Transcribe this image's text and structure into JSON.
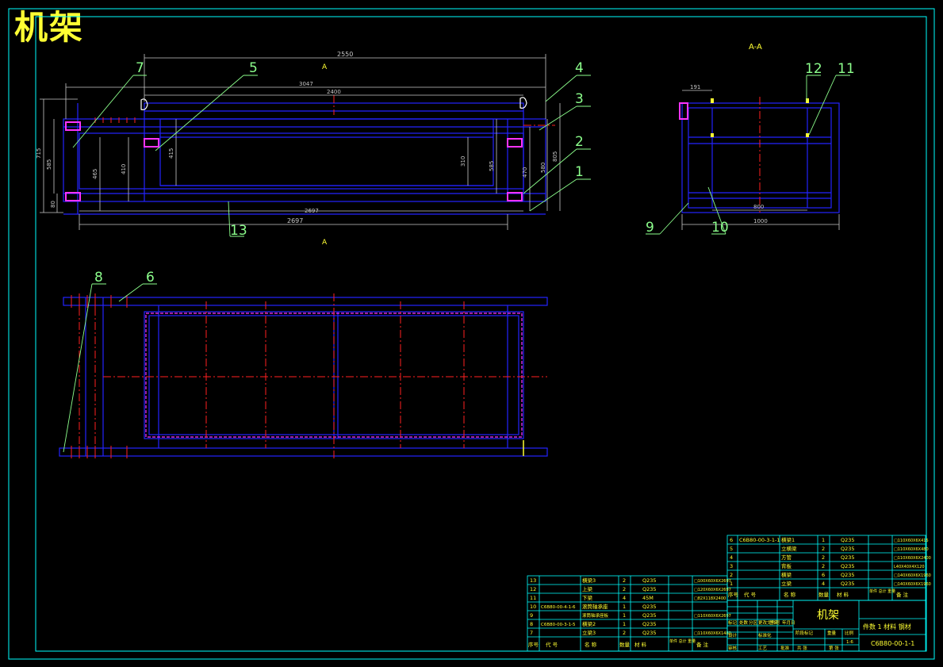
{
  "title": "机架",
  "section_label": "A-A",
  "section_marks": [
    "A",
    "A"
  ],
  "colors": {
    "background": "#000000",
    "frame": "#00ffff",
    "outline": "#2323ff",
    "center_line": "#ff2020",
    "dimension": "#c8c8c8",
    "leader": "#8cff8c",
    "bolt": "#ff33ff",
    "accent": "#ffff33"
  },
  "front_view": {
    "dims": {
      "d2550": "2550",
      "d3047": "3047",
      "d2400": "2400",
      "d2697a": "2697",
      "d2697b": "2697",
      "d715": "715",
      "d585a": "585",
      "d80": "80",
      "d465": "465",
      "d410": "410",
      "d415": "415",
      "d310": "310",
      "d585b": "585",
      "d470": "470",
      "d580": "580",
      "d805": "805"
    },
    "balloons": {
      "b7": "7",
      "b5": "5",
      "b4": "4",
      "b3": "3",
      "b2": "2",
      "b1": "1",
      "b13": "13"
    }
  },
  "section_view": {
    "dims": {
      "d191": "191",
      "d800": "800",
      "d1000": "1000"
    },
    "balloons": {
      "b12": "12",
      "b11": "11",
      "b9": "9",
      "b10": "10"
    }
  },
  "top_view": {
    "balloons": {
      "b8": "8",
      "b6": "6"
    }
  },
  "bom_right": {
    "rows": [
      [
        "6",
        "C6B80-00-3-1-1",
        "横梁1",
        "1",
        "Q235",
        "□110X60X6X415"
      ],
      [
        "5",
        "",
        "立横梁",
        "2",
        "Q235",
        "□110X60X6X480"
      ],
      [
        "4",
        "",
        "方管",
        "2",
        "Q235",
        "□110X60X6X2400"
      ],
      [
        "3",
        "",
        "背板",
        "2",
        "Q235",
        "L40X40X4X120"
      ],
      [
        "2",
        "",
        "横梁",
        "6",
        "Q235",
        "□140X60X6X1960"
      ],
      [
        "1",
        "",
        "立梁",
        "4",
        "Q235",
        "□140X60X6X1960"
      ]
    ],
    "header": [
      "序号",
      "代  号",
      "名  称",
      "数量",
      "材  料",
      "单件 总计 重量",
      "备  注"
    ]
  },
  "bom_left": {
    "rows": [
      [
        "13",
        "",
        "横梁3",
        "2",
        "Q235",
        "□100X60X6X2697"
      ],
      [
        "12",
        "",
        "上梁",
        "2",
        "Q235",
        "□120X60X6X2697"
      ],
      [
        "11",
        "",
        "下梁",
        "4",
        "45M",
        "□82X118X2400"
      ],
      [
        "10",
        "C6B80-00-4-1-6",
        "滚筒轴承座",
        "1",
        "Q235",
        ""
      ],
      [
        "9",
        "",
        "滚筒轴承座板",
        "1",
        "Q235",
        "□110X60X6X2697"
      ],
      [
        "8",
        "C6B80-00-3-1-5",
        "横梁2",
        "1",
        "Q235",
        ""
      ],
      [
        "7",
        "",
        "立梁3",
        "2",
        "Q235",
        "□110X60X6X1480"
      ]
    ],
    "header": [
      "序号",
      "代  号",
      "名  称",
      "数量",
      "材  料",
      "单件 总计 重量",
      "备  注"
    ]
  },
  "title_block": {
    "name": "机架",
    "material_note": "件数 1  材料 钢材",
    "drawing_no": "C6B80-00-1-1",
    "cells": [
      "标记",
      "处数",
      "分区",
      "更改文件号",
      "签名",
      "年月日",
      "设计",
      "标准化",
      "阶段标记",
      "重量",
      "比例",
      "审核",
      "工艺",
      "批准",
      "共 张",
      "第 张",
      "1:6"
    ]
  }
}
